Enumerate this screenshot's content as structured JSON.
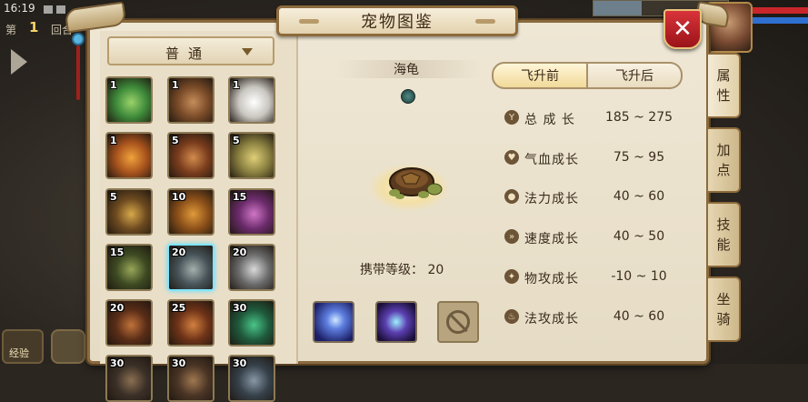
{
  "status": {
    "time": "16:19"
  },
  "battle": {
    "round_prefix": "第",
    "round_number": "1",
    "round_suffix": "回合"
  },
  "bottom_left": {
    "button_a_text": "经验"
  },
  "panel": {
    "title": "宠物图鉴",
    "close_glyph": "✕"
  },
  "filter": {
    "selected": "普通"
  },
  "pets": [
    {
      "level": "1",
      "colors": [
        "#3e8a3a",
        "#9ad36a"
      ]
    },
    {
      "level": "1",
      "colors": [
        "#7a4b28",
        "#c58d5a"
      ]
    },
    {
      "level": "1",
      "colors": [
        "#c9c6c0",
        "#ffffff"
      ]
    },
    {
      "level": "1",
      "colors": [
        "#a8531d",
        "#f0a33b"
      ]
    },
    {
      "level": "5",
      "colors": [
        "#7a3d1d",
        "#d28b4d"
      ]
    },
    {
      "level": "5",
      "colors": [
        "#8a8040",
        "#e0cf78"
      ]
    },
    {
      "level": "5",
      "colors": [
        "#6d4a20",
        "#d7a84a"
      ]
    },
    {
      "level": "10",
      "colors": [
        "#8c5019",
        "#e09a3a"
      ]
    },
    {
      "level": "15",
      "colors": [
        "#6b2b6b",
        "#d076c6"
      ]
    },
    {
      "level": "15",
      "colors": [
        "#3d4a22",
        "#97a658"
      ]
    },
    {
      "level": "20",
      "colors": [
        "#465358",
        "#a4b0ad"
      ]
    },
    {
      "level": "20",
      "colors": [
        "#6a6a6a",
        "#d9d9d9"
      ]
    },
    {
      "level": "20",
      "colors": [
        "#5a2d17",
        "#c0723a"
      ]
    },
    {
      "level": "25",
      "colors": [
        "#6e3318",
        "#d2803f"
      ]
    },
    {
      "level": "30",
      "colors": [
        "#1f5a3c",
        "#49c488"
      ]
    },
    {
      "level": "30",
      "colors": [
        "#3b3027",
        "#8a6f52"
      ]
    },
    {
      "level": "30",
      "colors": [
        "#4a3525",
        "#a07850"
      ]
    },
    {
      "level": "30",
      "colors": [
        "#36414a",
        "#8797a5"
      ]
    }
  ],
  "selected_pet": {
    "name": "海龟",
    "element_glyph": "水",
    "carry_level_label": "携带等级：",
    "carry_level_value": "20"
  },
  "tabs": {
    "before": "飞升前",
    "after": "飞升后"
  },
  "stats": [
    {
      "icon": "Y",
      "name": "总 成 长",
      "value": "185 ~ 275"
    },
    {
      "icon": "♥",
      "name": "气血成长",
      "value": "75 ~ 95"
    },
    {
      "icon": "●",
      "name": "法力成长",
      "value": "40 ~ 60"
    },
    {
      "icon": "»",
      "name": "速度成长",
      "value": "40 ~ 50"
    },
    {
      "icon": "✦",
      "name": "物攻成长",
      "value": "-10 ~ 10"
    },
    {
      "icon": "♨",
      "name": "法攻成长",
      "value": "40 ~ 60"
    }
  ],
  "side_tabs": [
    {
      "line1": "属",
      "line2": "性"
    },
    {
      "line1": "加",
      "line2": "点"
    },
    {
      "line1": "技",
      "line2": "能"
    },
    {
      "line1": "坐",
      "line2": "骑"
    }
  ]
}
